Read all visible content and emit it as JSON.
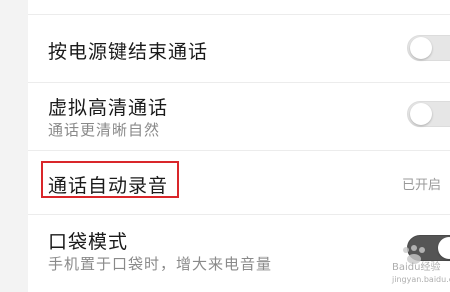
{
  "settings": {
    "items": [
      {
        "title": "按电源键结束通话",
        "subtitle": "",
        "control": "toggle",
        "state": "off"
      },
      {
        "title": "虚拟高清通话",
        "subtitle": "通话更清晰自然",
        "control": "toggle",
        "state": "off"
      },
      {
        "title": "通话自动录音",
        "subtitle": "",
        "control": "status",
        "status_text": "已开启"
      },
      {
        "title": "口袋模式",
        "subtitle": "手机置于口袋时，增大来电音量",
        "control": "toggle",
        "state": "on"
      }
    ]
  },
  "annotation": {
    "highlight_color": "#d9262a",
    "highlighted_item": "通话自动录音"
  },
  "watermark": {
    "line1": "Baidu经验",
    "line2": "jingyan.baidu.com"
  },
  "colors": {
    "background": "#f3f3f3",
    "card": "#ffffff",
    "toggle_off": "#e6e6e6",
    "toggle_on": "#555555"
  }
}
